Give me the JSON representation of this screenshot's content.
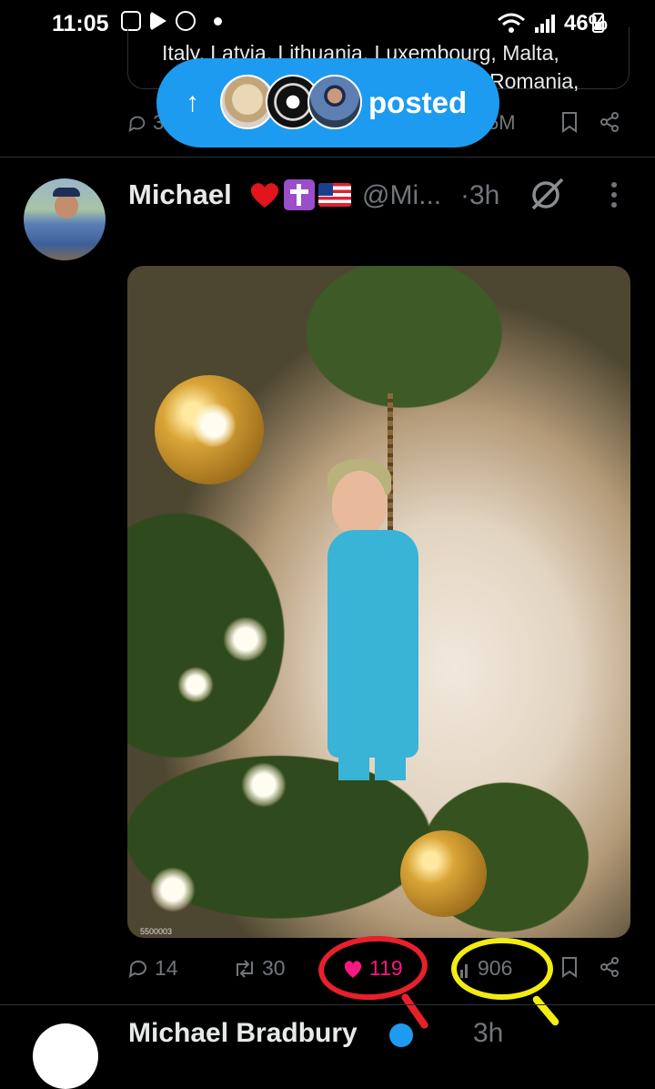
{
  "status_bar": {
    "time": "11:05",
    "battery": "46%",
    "icons": [
      "gallery-icon",
      "play-store-icon",
      "circle-app-icon",
      "dot-icon",
      "wifi-icon",
      "signal-icon",
      "battery-icon"
    ]
  },
  "previous_tweet": {
    "quote_line1": "Italy, Latvia, Lithuania, Luxembourg, Malta,",
    "quote_line2": "Romania,",
    "reply_count": "3",
    "view_count": "6M"
  },
  "posted_pill": {
    "label": "posted",
    "arrow": "↑"
  },
  "tweet": {
    "author_name": "Michael",
    "handle": "@Mi...",
    "time": "·3h",
    "media_watermark": "5500003",
    "actions": {
      "reply": "14",
      "retweet": "30",
      "like": "119",
      "views": "906"
    }
  },
  "next_tweet": {
    "author_name": "Michael Bradbury",
    "time": "3h"
  },
  "colors": {
    "background": "#000000",
    "accent_blue": "#1d9bf0",
    "like_pink": "#f91880",
    "annotation_red": "#e8202b",
    "annotation_yellow": "#f2ec12"
  }
}
